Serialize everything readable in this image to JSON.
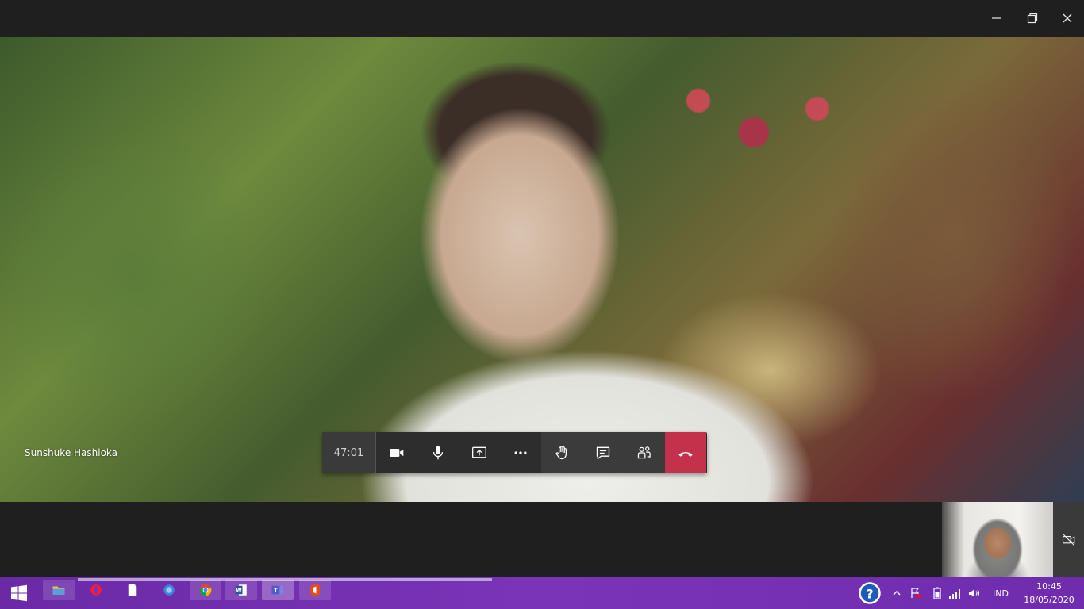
{
  "window": {
    "controls": {
      "minimize": "minimize-icon",
      "maximize": "restore-icon",
      "close": "close-icon"
    }
  },
  "video": {
    "participant_name": "Sunshuke Hashioka"
  },
  "call_controls": {
    "timer": "47:01",
    "buttons": [
      "camera-icon",
      "microphone-icon",
      "share-screen-icon",
      "more-options-icon",
      "raise-hand-icon",
      "chat-icon",
      "participants-icon",
      "hang-up-icon"
    ],
    "hangup_color": "#c4314b"
  },
  "taskbar": {
    "accent": "#7a34b8",
    "apps": [
      "file-explorer-icon",
      "opera-icon",
      "notepad-icon",
      "browser-icon",
      "chrome-icon",
      "word-icon",
      "teams-icon",
      "office-icon"
    ],
    "tray": {
      "language": "IND",
      "time": "10:45",
      "date": "18/05/2020"
    }
  }
}
